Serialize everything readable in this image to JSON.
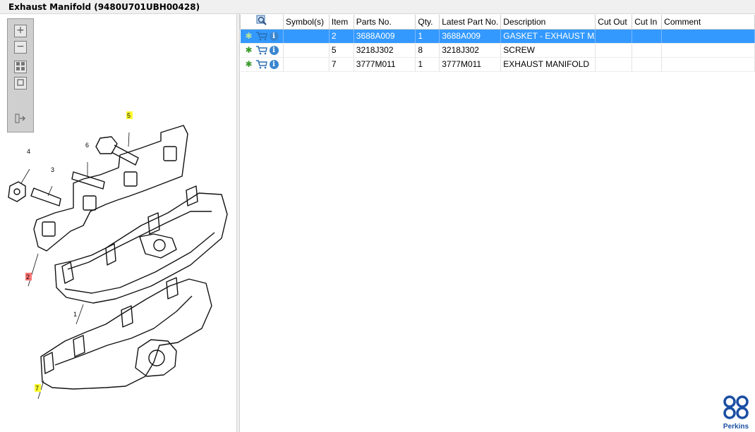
{
  "window": {
    "title": "Exhaust Manifold (9480U701UBH00428)"
  },
  "toolbar": {
    "zoom_in_icon": "plus-icon",
    "zoom_out_icon": "minus-icon",
    "fit_icon": "grid-icon",
    "actual_icon": "square-icon",
    "export_icon": "export-icon"
  },
  "diagram": {
    "callouts": [
      {
        "label": "5",
        "highlight": "#ffff33"
      },
      {
        "label": "4",
        "highlight": ""
      },
      {
        "label": "6",
        "highlight": ""
      },
      {
        "label": "3",
        "highlight": ""
      },
      {
        "label": "2",
        "highlight": "#ff7777"
      },
      {
        "label": "1",
        "highlight": ""
      },
      {
        "label": "7",
        "highlight": "#ffff33"
      }
    ]
  },
  "table": {
    "headers": {
      "search": "search-magnifier-icon",
      "symbols": "Symbol(s)",
      "item": "Item",
      "parts_no": "Parts No.",
      "qty": "Qty.",
      "latest_part_no": "Latest Part No.",
      "description": "Description",
      "cut_out": "Cut Out",
      "cut_in": "Cut In",
      "comment": "Comment"
    },
    "rows": [
      {
        "item": "2",
        "parts_no": "3688A009",
        "qty": "1",
        "latest_part_no": "3688A009",
        "description": "GASKET - EXHAUST MANIF",
        "cut_out": "",
        "cut_in": "",
        "comment": ""
      },
      {
        "item": "5",
        "parts_no": "3218J302",
        "qty": "8",
        "latest_part_no": "3218J302",
        "description": "SCREW",
        "cut_out": "",
        "cut_in": "",
        "comment": ""
      },
      {
        "item": "7",
        "parts_no": "3777M011",
        "qty": "1",
        "latest_part_no": "3777M011",
        "description": "EXHAUST MANIFOLD",
        "cut_out": "",
        "cut_in": "",
        "comment": ""
      }
    ],
    "selected_row": 0,
    "selection_color": "#3399ff"
  },
  "branding": {
    "logo_text": "Perkins",
    "logo_color": "#1a4ea3"
  }
}
